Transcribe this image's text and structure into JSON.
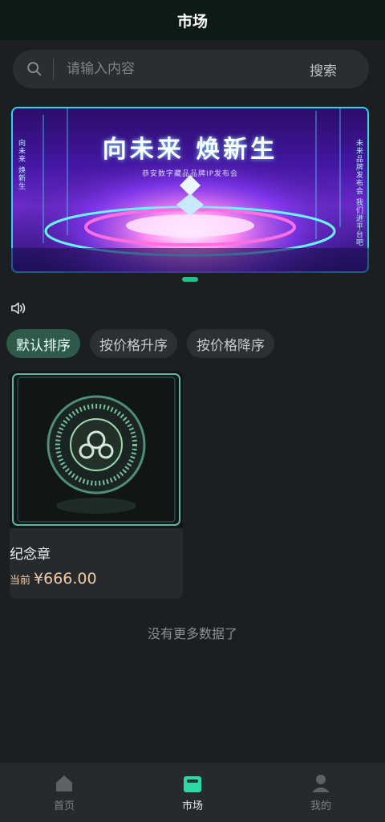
{
  "header": {
    "title": "市场"
  },
  "search": {
    "placeholder": "请输入内容",
    "button_label": "搜索"
  },
  "banner": {
    "title": "向未来 焕新生",
    "subtitle": "恭安数字藏品品牌IP发布会",
    "side_left": "向未来 焕新生",
    "side_right": "未来品牌发布会 我们进平台吧"
  },
  "sort": {
    "options": [
      "默认排序",
      "按价格升序",
      "按价格降序"
    ],
    "active_index": 0
  },
  "products": [
    {
      "name": "纪念章",
      "price_label": "当前",
      "price": "¥666.00"
    }
  ],
  "list_end_text": "没有更多数据了",
  "tabbar": {
    "items": [
      {
        "label": "首页",
        "icon": "home-icon"
      },
      {
        "label": "市场",
        "icon": "market-icon"
      },
      {
        "label": "我的",
        "icon": "profile-icon"
      }
    ],
    "active_index": 1
  },
  "colors": {
    "accent": "#22c18b",
    "background": "#1c1f22",
    "price": "#f0c9a6"
  }
}
